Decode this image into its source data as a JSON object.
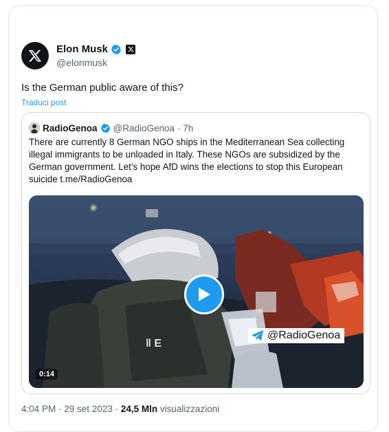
{
  "post": {
    "author_name": "Elon Musk",
    "author_handle": "@elonmusk",
    "text": "Is the German public aware of this?",
    "translate_label": "Traduci post",
    "timestamp": "4:04 PM · 29 set 2023",
    "dot": "·",
    "views_count": "24,5 Mln",
    "views_label": "visualizzazioni"
  },
  "quote": {
    "author_name": "RadioGenoa",
    "author_handle": "@RadioGenoa",
    "time": "· 7h",
    "text": "There are currently 8 German NGO ships in the Mediterranean Sea collecting illegal immigrants to be unloaded in Italy. These NGOs are subsidized by the German government. Let's hope AfD wins the elections to stop this European suicide t.me/RadioGenoa",
    "video_watermark": "@RadioGenoa",
    "video_duration": "0:14"
  },
  "colors": {
    "accent": "#1d9bf0",
    "text": "#0f1419",
    "secondary": "#536471",
    "border": "#cfd9de"
  },
  "icons": {
    "avatar": "x-logo-icon",
    "verified": "verified-badge-icon",
    "affiliate": "x-badge-icon",
    "play": "play-icon",
    "watermark": "telegram-icon"
  }
}
